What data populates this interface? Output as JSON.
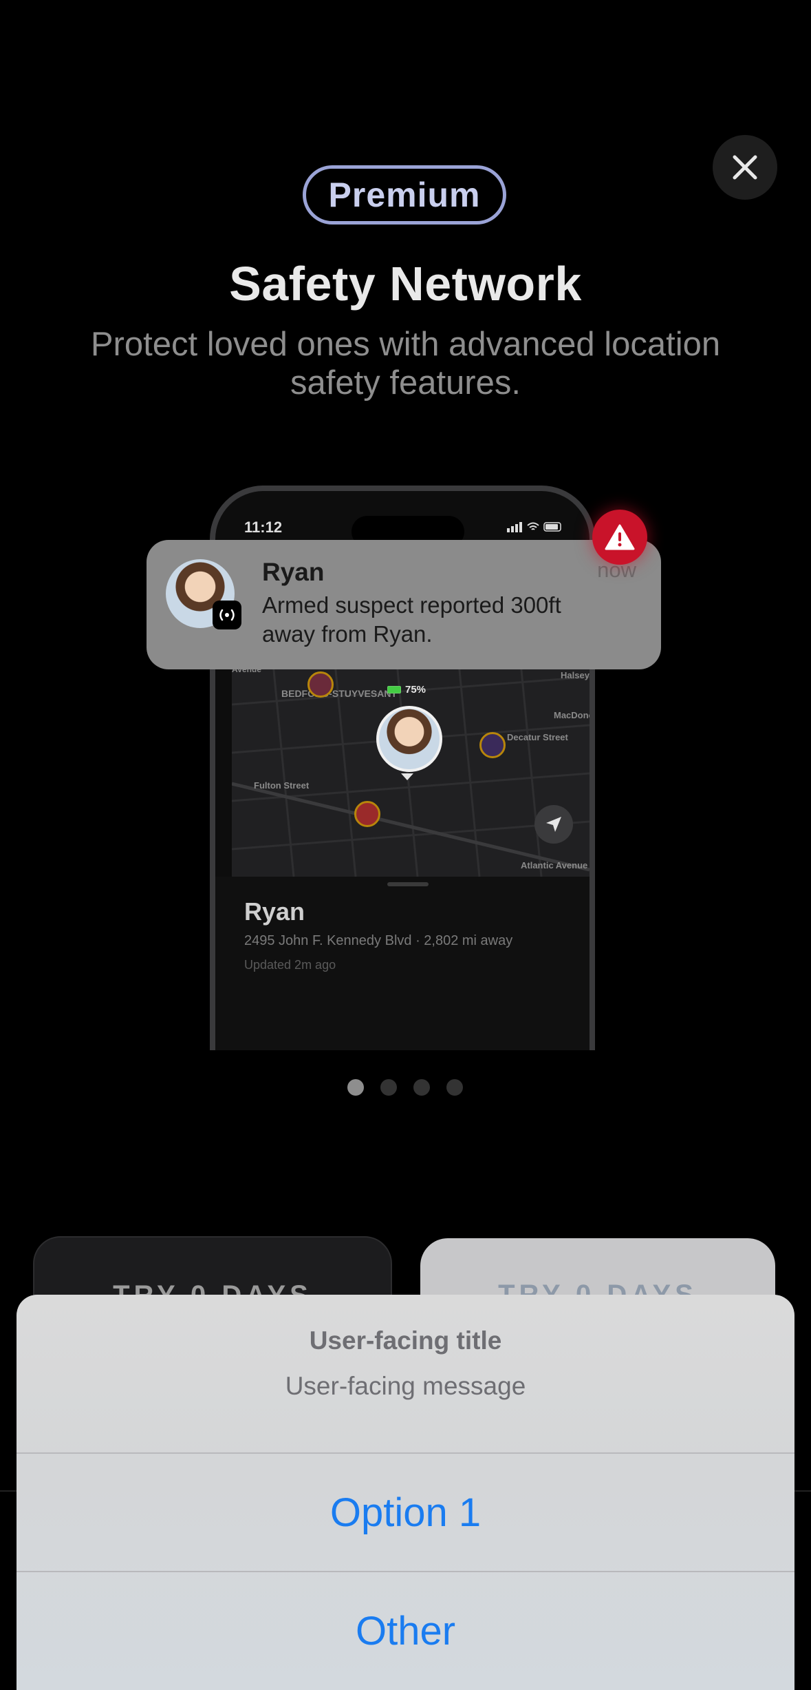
{
  "header": {
    "badge": "Premium",
    "title": "Safety Network",
    "subtitle": "Protect loved ones with advanced location safety features."
  },
  "phone": {
    "status_time": "11:12",
    "map": {
      "labels": [
        "BEDFORD-STUYVESANT",
        "Fulton Street",
        "Decatur Street",
        "MacDonough",
        "Halsey",
        "Atlantic Avenue",
        "Avenue"
      ],
      "battery": "75%"
    },
    "sheet": {
      "name": "Ryan",
      "address": "2495 John F. Kennedy Blvd · 2,802 mi away",
      "updated": "Updated 2m ago"
    }
  },
  "notification": {
    "name": "Ryan",
    "message": "Armed suspect reported 300ft away from Ryan.",
    "time": "now",
    "alert_icon": "warning-triangle-icon"
  },
  "pagination": {
    "count": 4,
    "active": 0
  },
  "trial_buttons": {
    "left_label": "TRY 0 DAYS",
    "right_label": "TRY 0 DAYS"
  },
  "action_sheet": {
    "title": "User-facing title",
    "message": "User-facing message",
    "options": [
      {
        "label": "Option 1"
      },
      {
        "label": "Other"
      }
    ]
  },
  "colors": {
    "background": "#000000",
    "accent_blue": "#1a7cf0",
    "alert_red": "#c9132a",
    "premium_border": "#9aa3d6"
  }
}
